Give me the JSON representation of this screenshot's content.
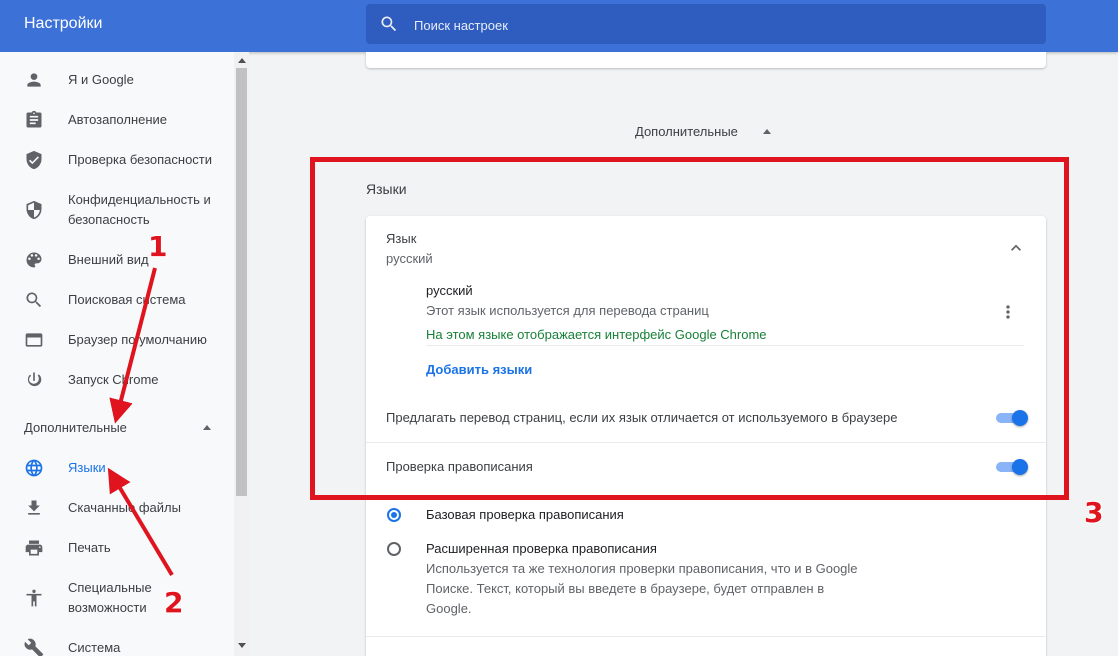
{
  "header": {
    "title": "Настройки",
    "search_placeholder": "Поиск настроек"
  },
  "sidebar": {
    "items": [
      {
        "label": "Я и Google",
        "icon": "person-icon"
      },
      {
        "label": "Автозаполнение",
        "icon": "clipboard-icon"
      },
      {
        "label": "Проверка безопасности",
        "icon": "shield-check-icon"
      },
      {
        "label": "Конфиденциальность и",
        "label2": "безопасность",
        "icon": "shield-icon"
      },
      {
        "label": "Внешний вид",
        "icon": "palette-icon"
      },
      {
        "label": "Поисковая система",
        "icon": "search-icon"
      },
      {
        "label": "Браузер по умолчанию",
        "icon": "browser-icon"
      },
      {
        "label": "Запуск Chrome",
        "icon": "power-icon"
      }
    ],
    "advanced_label": "Дополнительные",
    "advanced_items": [
      {
        "label": "Языки",
        "icon": "globe-icon",
        "active": true
      },
      {
        "label": "Скачанные файлы",
        "icon": "download-icon"
      },
      {
        "label": "Печать",
        "icon": "print-icon"
      },
      {
        "label": "Специальные",
        "label2": "возможности",
        "icon": "accessibility-icon"
      },
      {
        "label": "Система",
        "icon": "wrench-icon"
      }
    ]
  },
  "main": {
    "advanced_title": "Дополнительные",
    "languages_section": "Языки",
    "language": {
      "title": "Язык",
      "value": "русский"
    },
    "lang_entry": {
      "name": "русский",
      "desc": "Этот язык используется для перевода страниц",
      "ui_note": "На этом языке отображается интерфейс Google Chrome"
    },
    "add_languages": "Добавить языки",
    "translate_offer": {
      "label": "Предлагать перевод страниц, если их язык отличается от используемого в браузере",
      "enabled": true
    },
    "spellcheck": {
      "label": "Проверка правописания",
      "enabled": true
    },
    "spell_basic": {
      "label": "Базовая проверка правописания",
      "selected": true
    },
    "spell_enhanced": {
      "label": "Расширенная проверка правописания",
      "desc1": "Используется та же технология проверки правописания, что и в Google",
      "desc2": "Поиске. Текст, который вы введете в браузере, будет отправлен в",
      "desc3": "Google.",
      "selected": false
    }
  },
  "annotations": {
    "n1": "1",
    "n2": "2",
    "n3": "3",
    "color": "#e0141e"
  },
  "colors": {
    "header": "#3c71d8",
    "accent": "#1a73e8",
    "green_text": "#188038"
  }
}
